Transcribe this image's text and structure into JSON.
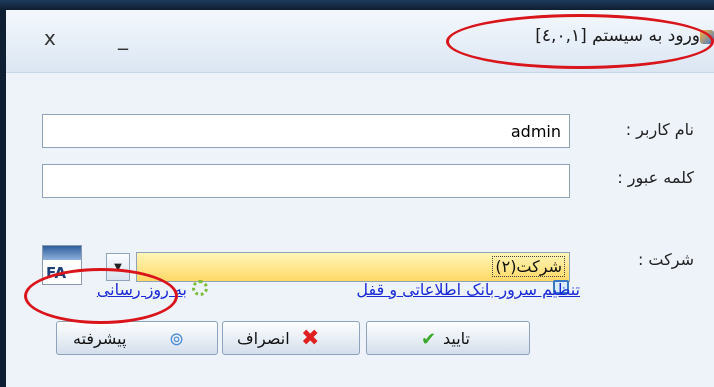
{
  "window": {
    "title": "ورود به سیستم [٤,٠,١]",
    "close_glyph": "x",
    "minimize_glyph": "_"
  },
  "form": {
    "username_label": "نام کاربر :",
    "username_value": "admin",
    "password_label": "کلمه عبور :",
    "password_value": "",
    "company_label": "شرکت :",
    "company_value": "شرکت(۲)",
    "language_badge": "FA"
  },
  "links": {
    "server_setup": "تنظیم سرور بانک اطلاعاتی و قفل",
    "update": "به روز رسانی"
  },
  "buttons": {
    "ok": "تایید",
    "cancel": "انصراف",
    "advanced": "پیشرفته"
  },
  "colors": {
    "annotation": "#d9141a",
    "combo_highlight": "#ffd966",
    "link": "#1a2ad8"
  },
  "icons": [
    "app-icon",
    "close-icon",
    "minimize-icon",
    "language-flag-icon",
    "dropdown-arrow-icon",
    "monitor-icon",
    "gear-icon",
    "checkmark-icon",
    "red-x-icon",
    "advanced-icon"
  ]
}
